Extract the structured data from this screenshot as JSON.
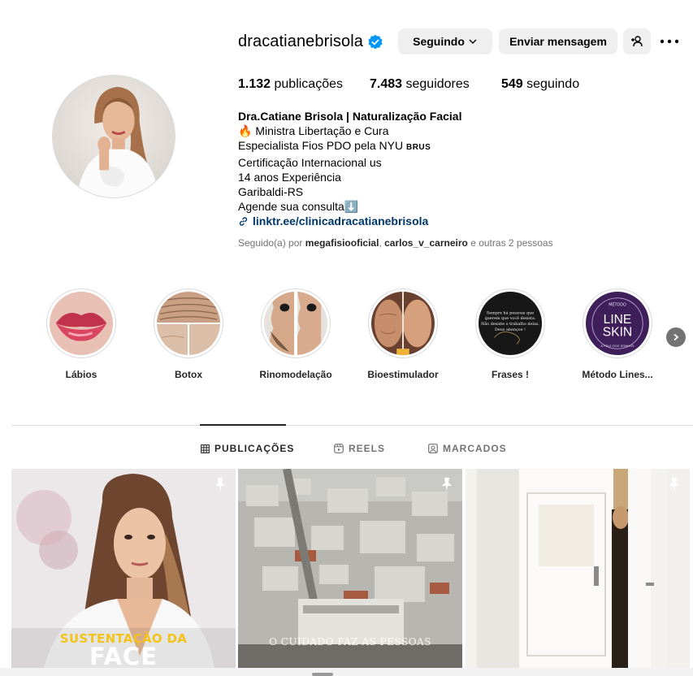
{
  "profile": {
    "username": "dracatianebrisola",
    "verified": true,
    "buttons": {
      "following": "Seguindo",
      "message": "Enviar mensagem"
    },
    "stats": {
      "posts_count": "1.132",
      "posts_label": "publicações",
      "followers_count": "7.483",
      "followers_label": "seguidores",
      "following_count": "549",
      "following_label": "seguindo"
    },
    "bio": {
      "name": "Dra.Catiane Brisola | Naturalização Facial",
      "line1": "🔥 Ministra Libertação e Cura",
      "line2_text": "Especialista Fios PDO pela NYU ",
      "line2_small": "BRUS",
      "line3": "Certificação Internacional us",
      "line4": "14 anos Experiência",
      "line5": "Garibaldi-RS",
      "line6": "Agende sua consulta⬇️",
      "link": "linktr.ee/clinicadracatianebrisola"
    },
    "followed_by": {
      "prefix": "Seguido(a) por",
      "user1": "megafisiooficial",
      "separator": ",",
      "user2": "carlos_v_carneiro",
      "suffix": "e outras 2 pessoas"
    }
  },
  "highlights": [
    {
      "label": "Lábios",
      "icon": "lips-image"
    },
    {
      "label": "Botox",
      "icon": "forehead-image"
    },
    {
      "label": "Rinomodelação",
      "icon": "nose-profile-image"
    },
    {
      "label": "Bioestimulador",
      "icon": "face-before-after-image"
    },
    {
      "label": "Frases !",
      "icon": "quote-image"
    },
    {
      "label": "Método Lines...",
      "icon": "line-skin-logo"
    }
  ],
  "highlight_quote_text": "Sempre há pessoas que querem que você desista. Não desiste o trabalho delas. Deus abençoe !",
  "line_skin": {
    "top": "MÉTODO",
    "line1": "LINE",
    "line2": "SKIN",
    "bottom": "A PELE DOS SONHOS"
  },
  "tabs": [
    {
      "label": "PUBLICAÇÕES",
      "icon": "grid-icon",
      "active": true
    },
    {
      "label": "REELS",
      "icon": "reels-icon",
      "active": false
    },
    {
      "label": "MARCADOS",
      "icon": "tagged-icon",
      "active": false
    }
  ],
  "posts": [
    {
      "caption_top": "SUSTENTAÇÃO DA",
      "caption_bottom": "FACE",
      "pinned": true
    },
    {
      "overlay_text": "O CUIDADO FAZ AS PESSOAS",
      "pinned": true
    },
    {
      "pinned": true
    }
  ],
  "colors": {
    "link": "#00376b",
    "verified": "#0095f6",
    "button_bg": "#efefef",
    "caption_yellow": "#f3c319"
  }
}
